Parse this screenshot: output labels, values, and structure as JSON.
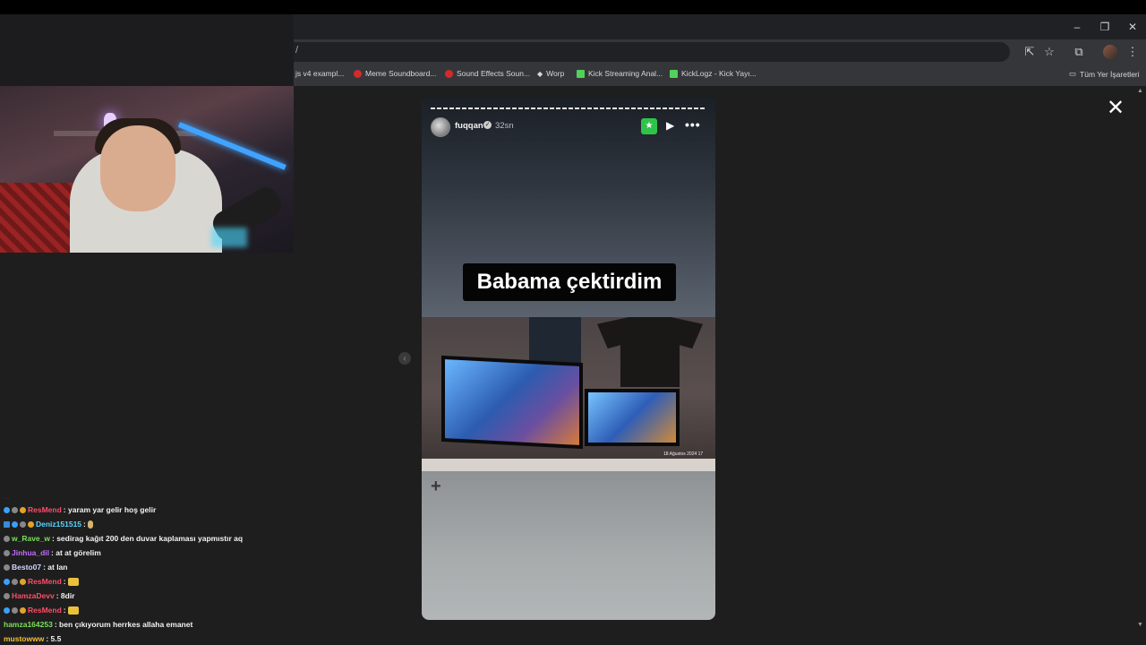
{
  "browser": {
    "omnibox_text": "/",
    "window_controls": [
      "–",
      "❐",
      "✕"
    ],
    "bookmarks": [
      {
        "label": "js v4 exampl...",
        "icon": "page-icon"
      },
      {
        "label": "Meme Soundboard...",
        "icon": "red-icon"
      },
      {
        "label": "Sound Effects Soun...",
        "icon": "red-icon"
      },
      {
        "label": "Worp",
        "icon": "diamond-icon"
      },
      {
        "label": "Kick Streaming Anal...",
        "icon": "chart-icon"
      },
      {
        "label": "KickLogz - Kick Yayı...",
        "icon": "kick-icon"
      }
    ],
    "all_bookmarks_label": "Tüm Yer İşaretleri"
  },
  "story": {
    "username": "fuqqan",
    "time": "32sn",
    "caption": "Babama çektirdim",
    "verified_glyph": "✓",
    "star_glyph": "★",
    "play_glyph": "▶",
    "more_glyph": "•••",
    "plus_glyph": "+",
    "photo_stamp": "18 Ağustos 2024 17",
    "close_glyph": "✕",
    "prev_glyph": "‹"
  },
  "chat": {
    "ghost_text": "...",
    "messages": [
      {
        "user": "ResMend",
        "color": "#ff4d6a",
        "text": ": yaram yar gelir hoş gelir",
        "badges": [
          "blue",
          "gray",
          "gold"
        ]
      },
      {
        "user": "Deniz151515",
        "color": "#59d6ff",
        "text": ":",
        "badges": [
          "sq",
          "blue",
          "gray",
          "gold"
        ],
        "emote": "emote2"
      },
      {
        "user": "w_Rave_w",
        "color": "#7be05a",
        "text": ": sedirag kağıt 200 den duvar kaplaması yapmıstır aq",
        "badges": [
          "gray"
        ]
      },
      {
        "user": "Jinhua_dil",
        "color": "#c56cff",
        "text": ": at at görelim",
        "badges": [
          "gray"
        ]
      },
      {
        "user": "Besto07",
        "color": "#cfd8ff",
        "text": ": at lan",
        "badges": [
          "gray"
        ]
      },
      {
        "user": "ResMend",
        "color": "#ff4d6a",
        "text": ":",
        "badges": [
          "blue",
          "gray",
          "gold"
        ],
        "emote": "emote"
      },
      {
        "user": "HamzaDevv",
        "color": "#ff4d6a",
        "text": ": 8dir",
        "badges": [
          "gray"
        ]
      },
      {
        "user": "ResMend",
        "color": "#ff4d6a",
        "text": ":",
        "badges": [
          "blue",
          "gray",
          "gold"
        ],
        "emote": "emote"
      },
      {
        "user": "hamza164253",
        "color": "#7be05a",
        "text": ": ben çıkıyorum herrkes allaha emanet",
        "badges": []
      },
      {
        "user": "mustowww",
        "color": "#f2c13a",
        "text": ": 5.5",
        "badges": []
      }
    ]
  }
}
